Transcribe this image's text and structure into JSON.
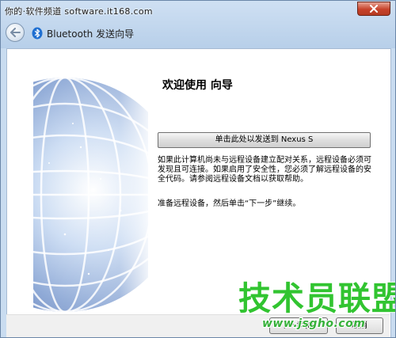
{
  "watermark": {
    "top_text": "你的·软件频道 software.it168.com",
    "site_logo_text": "技术员联盟",
    "site_url": "www.jsgho.com"
  },
  "window": {
    "nav_title": "Bluetooth 发送向导"
  },
  "wizard": {
    "title": "欢迎使用  向导",
    "send_button_label": "单击此处以发送到 Nexus S",
    "info_text": "如果此计算机尚未与远程设备建立配对关系，远程设备必须可发现且可连接。如果启用了安全性，您必须了解远程设备的安全代码。请参阅远程设备文档以获取帮助。",
    "prompt_text": "准备远程设备，然后单击“下一步”继续。"
  },
  "footer": {
    "next_label": "下一步(N)",
    "cancel_label": "取消"
  },
  "icons": {
    "close": "close-icon",
    "back": "back-arrow-icon",
    "bluetooth": "bluetooth-icon",
    "sphere": "globe-sphere-graphic"
  },
  "colors": {
    "frame": "#c9dcf0",
    "close_red": "#c7422a",
    "bluetooth_blue": "#1f6fd1",
    "logo_green": "#31c430"
  }
}
